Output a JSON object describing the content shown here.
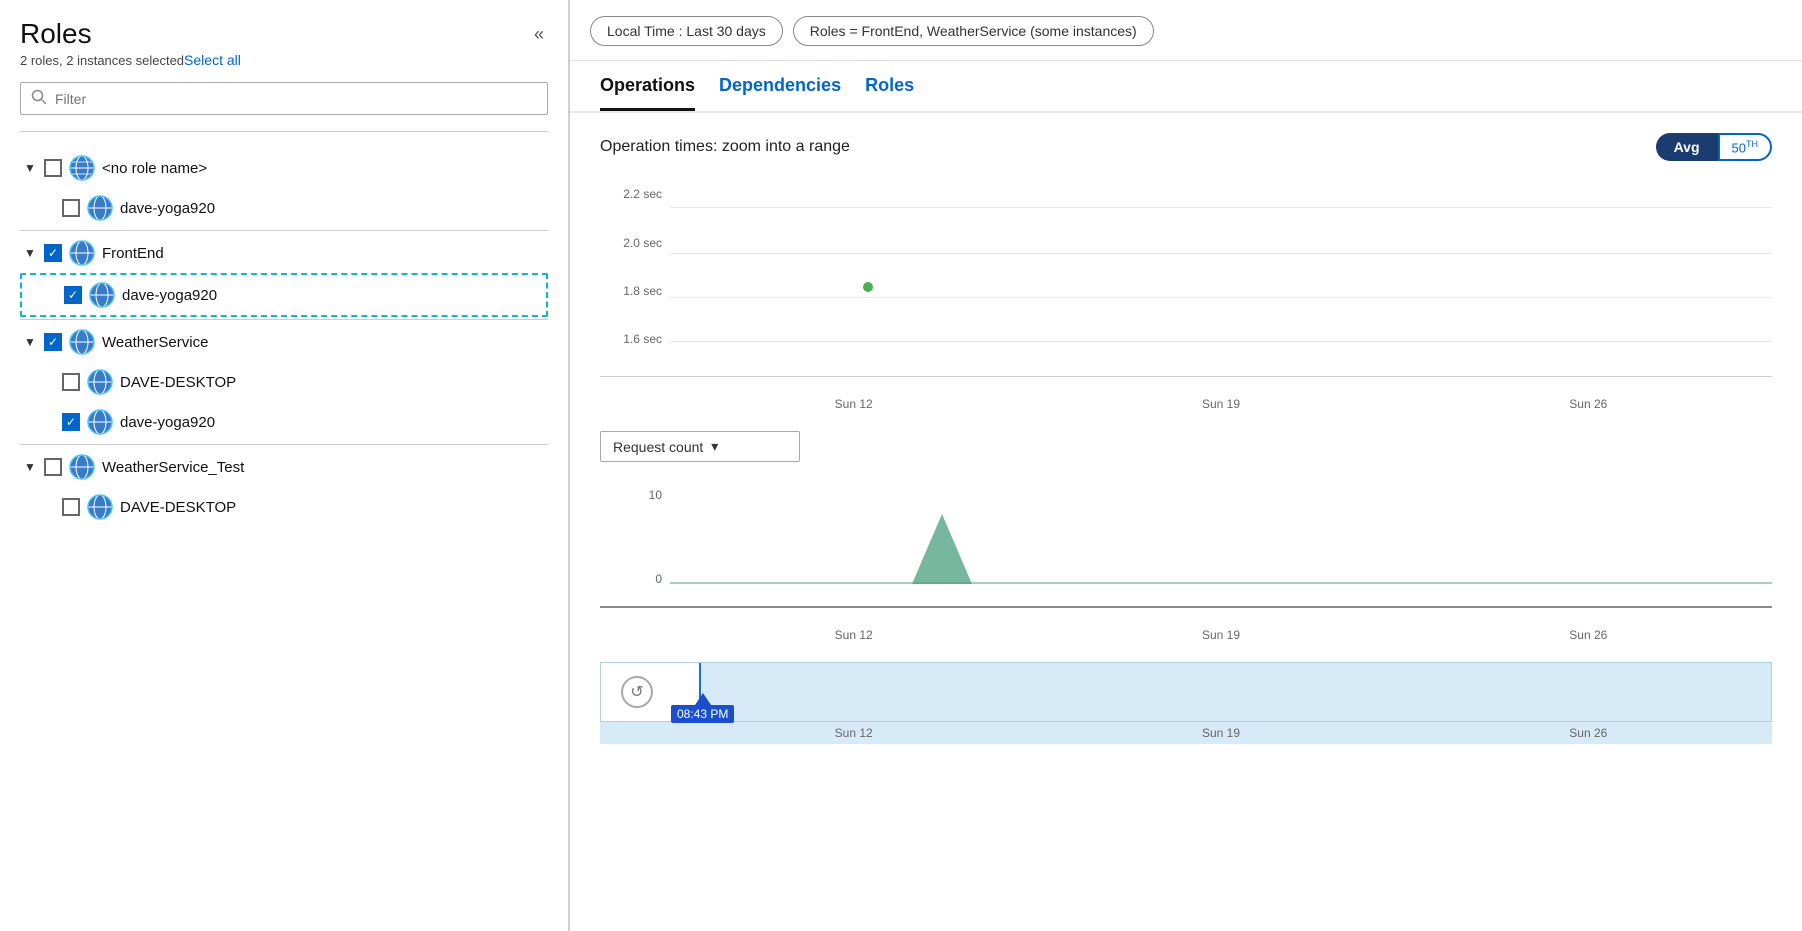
{
  "left_panel": {
    "title": "Roles",
    "subtitle": "2 roles, 2 instances selected",
    "select_all": "Select all",
    "filter_placeholder": "Filter",
    "tree": [
      {
        "id": "no-role",
        "label": "<no role name>",
        "checked": false,
        "expanded": true,
        "children": [
          {
            "id": "no-role-dave",
            "label": "dave-yoga920",
            "checked": false,
            "highlight": false
          }
        ]
      },
      {
        "id": "frontend",
        "label": "FrontEnd",
        "checked": true,
        "expanded": true,
        "children": [
          {
            "id": "frontend-dave",
            "label": "dave-yoga920",
            "checked": true,
            "highlight": true
          }
        ]
      },
      {
        "id": "weatherservice",
        "label": "WeatherService",
        "checked": true,
        "expanded": true,
        "children": [
          {
            "id": "ws-dave-desktop",
            "label": "DAVE-DESKTOP",
            "checked": false,
            "highlight": false
          },
          {
            "id": "ws-dave-yoga",
            "label": "dave-yoga920",
            "checked": true,
            "highlight": false
          }
        ]
      },
      {
        "id": "weatherservice-test",
        "label": "WeatherService_Test",
        "checked": false,
        "expanded": true,
        "children": [
          {
            "id": "wst-dave-desktop",
            "label": "DAVE-DESKTOP",
            "checked": false,
            "highlight": false
          }
        ]
      }
    ]
  },
  "right_panel": {
    "filter_pills": [
      {
        "id": "time-pill",
        "label": "Local Time : Last 30 days"
      },
      {
        "id": "roles-pill",
        "label": "Roles = FrontEnd, WeatherService (some instances)"
      }
    ],
    "tabs": [
      {
        "id": "operations",
        "label": "Operations",
        "active": true
      },
      {
        "id": "dependencies",
        "label": "Dependencies",
        "active": false
      },
      {
        "id": "roles",
        "label": "Roles",
        "active": false
      }
    ],
    "chart_section": {
      "title": "Operation times: zoom into a range",
      "avg_label": "Avg",
      "percentile_label": "50",
      "percentile_sup": "TH",
      "y_labels": [
        "2.2 sec",
        "2.0 sec",
        "1.8 sec",
        "1.6 sec"
      ],
      "x_labels": [
        "Sun 12",
        "Sun 19",
        "Sun 26"
      ]
    },
    "request_section": {
      "dropdown_label": "Request count",
      "y_labels": [
        "10",
        "0"
      ],
      "x_labels": [
        "Sun 12",
        "Sun 19",
        "Sun 26"
      ]
    },
    "range_section": {
      "x_labels": [
        "Sun 12",
        "Sun 19",
        "Sun 26"
      ],
      "time_marker": "08:43 PM",
      "reset_icon": "↺"
    }
  }
}
